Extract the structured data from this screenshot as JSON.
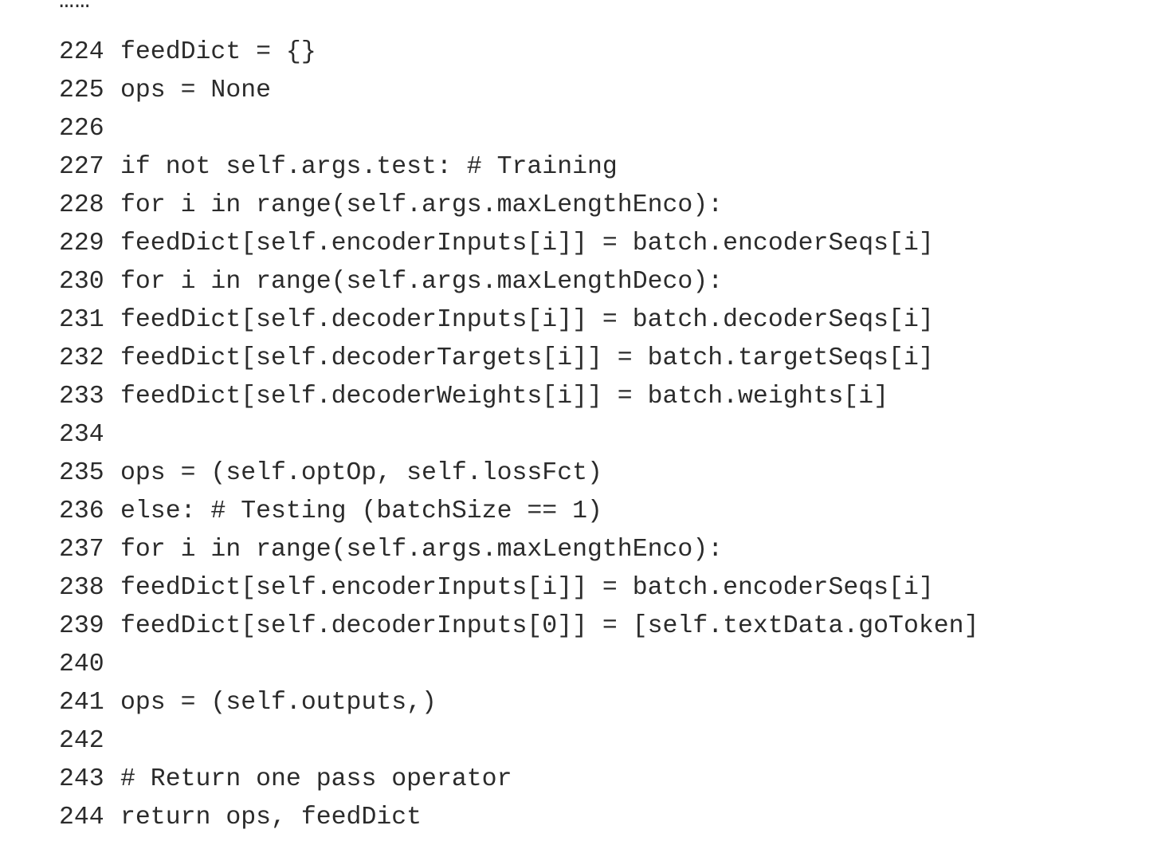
{
  "listing": {
    "ellipsis": "……",
    "lines": [
      {
        "number": "224",
        "code": "feedDict = {}"
      },
      {
        "number": "225",
        "code": "ops = None"
      },
      {
        "number": "226",
        "code": ""
      },
      {
        "number": "227",
        "code": "if not self.args.test: # Training"
      },
      {
        "number": "228",
        "code": "for i in range(self.args.maxLengthEnco):"
      },
      {
        "number": "229",
        "code": "feedDict[self.encoderInputs[i]] = batch.encoderSeqs[i]"
      },
      {
        "number": "230",
        "code": "for i in range(self.args.maxLengthDeco):"
      },
      {
        "number": "231",
        "code": "feedDict[self.decoderInputs[i]] = batch.decoderSeqs[i]"
      },
      {
        "number": "232",
        "code": "feedDict[self.decoderTargets[i]] = batch.targetSeqs[i]"
      },
      {
        "number": "233",
        "code": "feedDict[self.decoderWeights[i]] = batch.weights[i]"
      },
      {
        "number": "234",
        "code": ""
      },
      {
        "number": "235",
        "code": "ops = (self.optOp, self.lossFct)"
      },
      {
        "number": "236",
        "code": "else: # Testing (batchSize == 1)"
      },
      {
        "number": "237",
        "code": "for i in range(self.args.maxLengthEnco):"
      },
      {
        "number": "238",
        "code": "feedDict[self.encoderInputs[i]] = batch.encoderSeqs[i]"
      },
      {
        "number": "239",
        "code": "feedDict[self.decoderInputs[0]] = [self.textData.goToken]"
      },
      {
        "number": "240",
        "code": ""
      },
      {
        "number": "241",
        "code": "ops = (self.outputs,)"
      },
      {
        "number": "242",
        "code": ""
      },
      {
        "number": "243",
        "code": "# Return one pass operator"
      },
      {
        "number": "244",
        "code": "return ops, feedDict"
      }
    ]
  }
}
